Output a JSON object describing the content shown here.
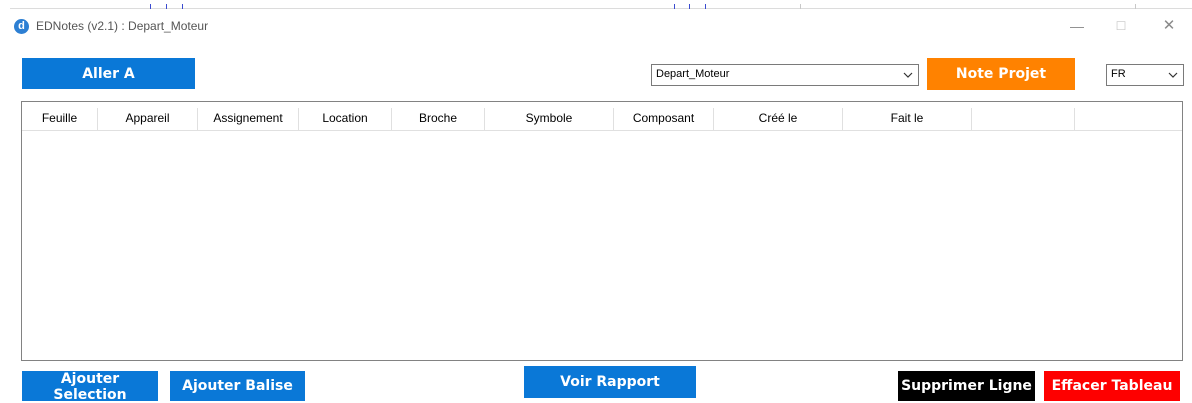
{
  "window": {
    "logo_letter": "d",
    "title": "EDNotes (v2.1) : Depart_Moteur",
    "minimize_glyph": "—",
    "maximize_glyph": "☐",
    "close_glyph": "✕"
  },
  "toolbar": {
    "goto_label": "Aller A",
    "project_select": {
      "value": "Depart_Moteur"
    },
    "project_note_label": "Note Projet",
    "language_select": {
      "value": "FR"
    }
  },
  "table": {
    "columns": [
      "Feuille",
      "Appareil",
      "Assignement",
      "Location",
      "Broche",
      "Symbole",
      "Composant",
      "Créé le",
      "Fait le",
      "",
      ""
    ],
    "rows": []
  },
  "actions": {
    "add_selection_label": "Ajouter Selection",
    "add_tag_label": "Ajouter Balise",
    "view_report_label": "Voir Rapport",
    "delete_row_label": "Supprimer Ligne",
    "clear_table_label": "Effacer Tableau"
  },
  "colors": {
    "primary_blue": "#0a78d7",
    "project_orange": "#ff8200",
    "delete_black": "#000000",
    "clear_red": "#fe0000"
  },
  "icons": {
    "app": "app-logo-icon",
    "dropdown": "chevron-down-icon",
    "minimize": "minimize-icon",
    "maximize": "maximize-icon",
    "close": "close-icon"
  }
}
